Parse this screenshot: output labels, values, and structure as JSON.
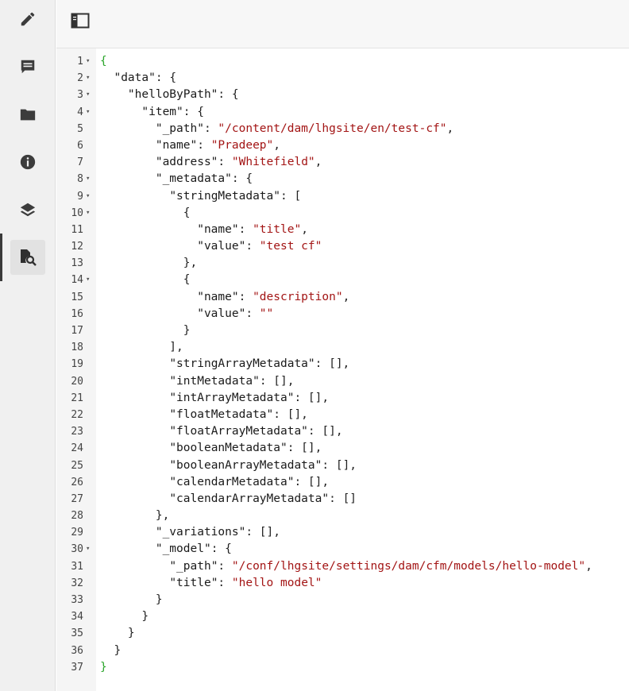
{
  "sidebar": {
    "items": [
      {
        "name": "edit-icon"
      },
      {
        "name": "comment-icon"
      },
      {
        "name": "folder-icon"
      },
      {
        "name": "info-icon"
      },
      {
        "name": "layers-icon"
      },
      {
        "name": "document-search-icon",
        "active": true
      }
    ]
  },
  "toolbar": {
    "toggle_icon": "panel-toggle-icon"
  },
  "editor": {
    "lines": [
      {
        "n": "1",
        "fold": true,
        "tokens": [
          [
            "g",
            "{"
          ]
        ]
      },
      {
        "n": "2",
        "fold": true,
        "tokens": [
          [
            "p",
            "  "
          ],
          [
            "k",
            "\"data\""
          ],
          [
            "p",
            ": {"
          ]
        ]
      },
      {
        "n": "3",
        "fold": true,
        "tokens": [
          [
            "p",
            "    "
          ],
          [
            "k",
            "\"helloByPath\""
          ],
          [
            "p",
            ": {"
          ]
        ]
      },
      {
        "n": "4",
        "fold": true,
        "tokens": [
          [
            "p",
            "      "
          ],
          [
            "k",
            "\"item\""
          ],
          [
            "p",
            ": {"
          ]
        ]
      },
      {
        "n": "5",
        "fold": false,
        "tokens": [
          [
            "p",
            "        "
          ],
          [
            "k",
            "\"_path\""
          ],
          [
            "p",
            ": "
          ],
          [
            "s",
            "\"/content/dam/lhgsite/en/test-cf\""
          ],
          [
            "p",
            ","
          ]
        ]
      },
      {
        "n": "6",
        "fold": false,
        "tokens": [
          [
            "p",
            "        "
          ],
          [
            "k",
            "\"name\""
          ],
          [
            "p",
            ": "
          ],
          [
            "s",
            "\"Pradeep\""
          ],
          [
            "p",
            ","
          ]
        ]
      },
      {
        "n": "7",
        "fold": false,
        "tokens": [
          [
            "p",
            "        "
          ],
          [
            "k",
            "\"address\""
          ],
          [
            "p",
            ": "
          ],
          [
            "s",
            "\"Whitefield\""
          ],
          [
            "p",
            ","
          ]
        ]
      },
      {
        "n": "8",
        "fold": true,
        "tokens": [
          [
            "p",
            "        "
          ],
          [
            "k",
            "\"_metadata\""
          ],
          [
            "p",
            ": {"
          ]
        ]
      },
      {
        "n": "9",
        "fold": true,
        "tokens": [
          [
            "p",
            "          "
          ],
          [
            "k",
            "\"stringMetadata\""
          ],
          [
            "p",
            ": ["
          ]
        ]
      },
      {
        "n": "10",
        "fold": true,
        "tokens": [
          [
            "p",
            "            {"
          ]
        ]
      },
      {
        "n": "11",
        "fold": false,
        "tokens": [
          [
            "p",
            "              "
          ],
          [
            "k",
            "\"name\""
          ],
          [
            "p",
            ": "
          ],
          [
            "s",
            "\"title\""
          ],
          [
            "p",
            ","
          ]
        ]
      },
      {
        "n": "12",
        "fold": false,
        "tokens": [
          [
            "p",
            "              "
          ],
          [
            "k",
            "\"value\""
          ],
          [
            "p",
            ": "
          ],
          [
            "s",
            "\"test cf\""
          ]
        ]
      },
      {
        "n": "13",
        "fold": false,
        "tokens": [
          [
            "p",
            "            },"
          ]
        ]
      },
      {
        "n": "14",
        "fold": true,
        "tokens": [
          [
            "p",
            "            {"
          ]
        ]
      },
      {
        "n": "15",
        "fold": false,
        "tokens": [
          [
            "p",
            "              "
          ],
          [
            "k",
            "\"name\""
          ],
          [
            "p",
            ": "
          ],
          [
            "s",
            "\"description\""
          ],
          [
            "p",
            ","
          ]
        ]
      },
      {
        "n": "16",
        "fold": false,
        "tokens": [
          [
            "p",
            "              "
          ],
          [
            "k",
            "\"value\""
          ],
          [
            "p",
            ": "
          ],
          [
            "s",
            "\"\""
          ]
        ]
      },
      {
        "n": "17",
        "fold": false,
        "tokens": [
          [
            "p",
            "            }"
          ]
        ]
      },
      {
        "n": "18",
        "fold": false,
        "tokens": [
          [
            "p",
            "          ],"
          ]
        ]
      },
      {
        "n": "19",
        "fold": false,
        "tokens": [
          [
            "p",
            "          "
          ],
          [
            "k",
            "\"stringArrayMetadata\""
          ],
          [
            "p",
            ": [],"
          ]
        ]
      },
      {
        "n": "20",
        "fold": false,
        "tokens": [
          [
            "p",
            "          "
          ],
          [
            "k",
            "\"intMetadata\""
          ],
          [
            "p",
            ": [],"
          ]
        ]
      },
      {
        "n": "21",
        "fold": false,
        "tokens": [
          [
            "p",
            "          "
          ],
          [
            "k",
            "\"intArrayMetadata\""
          ],
          [
            "p",
            ": [],"
          ]
        ]
      },
      {
        "n": "22",
        "fold": false,
        "tokens": [
          [
            "p",
            "          "
          ],
          [
            "k",
            "\"floatMetadata\""
          ],
          [
            "p",
            ": [],"
          ]
        ]
      },
      {
        "n": "23",
        "fold": false,
        "tokens": [
          [
            "p",
            "          "
          ],
          [
            "k",
            "\"floatArrayMetadata\""
          ],
          [
            "p",
            ": [],"
          ]
        ]
      },
      {
        "n": "24",
        "fold": false,
        "tokens": [
          [
            "p",
            "          "
          ],
          [
            "k",
            "\"booleanMetadata\""
          ],
          [
            "p",
            ": [],"
          ]
        ]
      },
      {
        "n": "25",
        "fold": false,
        "tokens": [
          [
            "p",
            "          "
          ],
          [
            "k",
            "\"booleanArrayMetadata\""
          ],
          [
            "p",
            ": [],"
          ]
        ]
      },
      {
        "n": "26",
        "fold": false,
        "tokens": [
          [
            "p",
            "          "
          ],
          [
            "k",
            "\"calendarMetadata\""
          ],
          [
            "p",
            ": [],"
          ]
        ]
      },
      {
        "n": "27",
        "fold": false,
        "tokens": [
          [
            "p",
            "          "
          ],
          [
            "k",
            "\"calendarArrayMetadata\""
          ],
          [
            "p",
            ": []"
          ]
        ]
      },
      {
        "n": "28",
        "fold": false,
        "tokens": [
          [
            "p",
            "        },"
          ]
        ]
      },
      {
        "n": "29",
        "fold": false,
        "tokens": [
          [
            "p",
            "        "
          ],
          [
            "k",
            "\"_variations\""
          ],
          [
            "p",
            ": [],"
          ]
        ]
      },
      {
        "n": "30",
        "fold": true,
        "tokens": [
          [
            "p",
            "        "
          ],
          [
            "k",
            "\"_model\""
          ],
          [
            "p",
            ": {"
          ]
        ]
      },
      {
        "n": "31",
        "fold": false,
        "tokens": [
          [
            "p",
            "          "
          ],
          [
            "k",
            "\"_path\""
          ],
          [
            "p",
            ": "
          ],
          [
            "s",
            "\"/conf/lhgsite/settings/dam/cfm/models/hello-model\""
          ],
          [
            "p",
            ","
          ]
        ]
      },
      {
        "n": "32",
        "fold": false,
        "tokens": [
          [
            "p",
            "          "
          ],
          [
            "k",
            "\"title\""
          ],
          [
            "p",
            ": "
          ],
          [
            "s",
            "\"hello model\""
          ]
        ]
      },
      {
        "n": "33",
        "fold": false,
        "tokens": [
          [
            "p",
            "        }"
          ]
        ]
      },
      {
        "n": "34",
        "fold": false,
        "tokens": [
          [
            "p",
            "      }"
          ]
        ]
      },
      {
        "n": "35",
        "fold": false,
        "tokens": [
          [
            "p",
            "    }"
          ]
        ]
      },
      {
        "n": "36",
        "fold": false,
        "tokens": [
          [
            "p",
            "  }"
          ]
        ]
      },
      {
        "n": "37",
        "fold": false,
        "tokens": [
          [
            "g",
            "}"
          ]
        ]
      }
    ]
  }
}
